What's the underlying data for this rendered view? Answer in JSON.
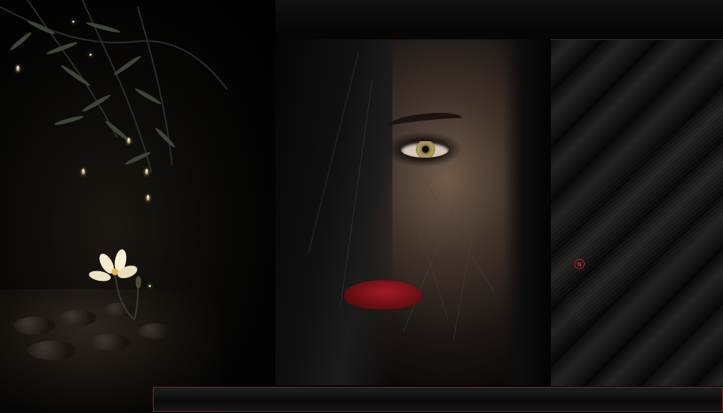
{
  "scene": {
    "left_panel": {
      "subject": "night-flower",
      "accent": "#f6dc9c"
    },
    "center_panel": {
      "subject": "dark-haired-portrait",
      "lip_color": "#8a1219"
    },
    "right_panel": {
      "subject": "diagonal-metal-stripes"
    },
    "top_strip": {
      "color": "#0a0a0a"
    },
    "bottom_bar": {
      "border_color": "#b0131b"
    },
    "logo": {
      "icon": "circular-monogram-icon",
      "color": "#c0282e"
    }
  }
}
